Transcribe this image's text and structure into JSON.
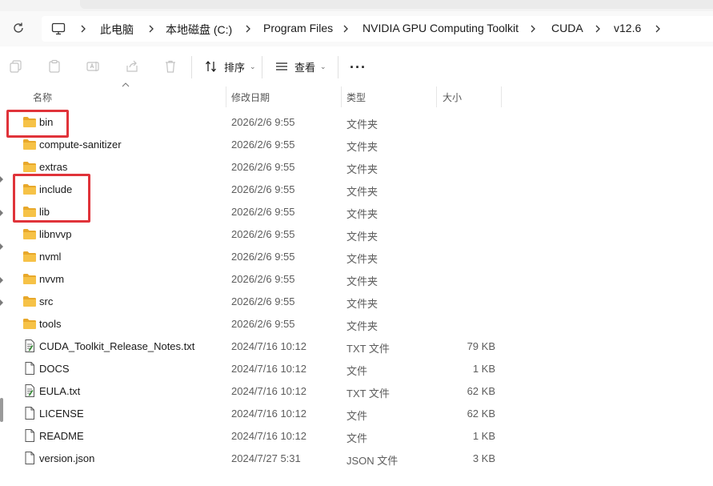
{
  "breadcrumb": [
    "此电脑",
    "本地磁盘 (C:)",
    "Program Files",
    "NVIDIA GPU Computing Toolkit",
    "CUDA",
    "v12.6"
  ],
  "toolbar": {
    "sort_label": "排序",
    "view_label": "查看"
  },
  "columns": {
    "name": "名称",
    "date": "修改日期",
    "type": "类型",
    "size": "大小"
  },
  "files": [
    {
      "name": "bin",
      "date": "2026/2/6 9:55",
      "type": "文件夹",
      "size": "",
      "icon": "folder-icon"
    },
    {
      "name": "compute-sanitizer",
      "date": "2026/2/6 9:55",
      "type": "文件夹",
      "size": "",
      "icon": "folder-icon"
    },
    {
      "name": "extras",
      "date": "2026/2/6 9:55",
      "type": "文件夹",
      "size": "",
      "icon": "folder-icon"
    },
    {
      "name": "include",
      "date": "2026/2/6 9:55",
      "type": "文件夹",
      "size": "",
      "icon": "folder-icon"
    },
    {
      "name": "lib",
      "date": "2026/2/6 9:55",
      "type": "文件夹",
      "size": "",
      "icon": "folder-icon"
    },
    {
      "name": "libnvvp",
      "date": "2026/2/6 9:55",
      "type": "文件夹",
      "size": "",
      "icon": "folder-icon"
    },
    {
      "name": "nvml",
      "date": "2026/2/6 9:55",
      "type": "文件夹",
      "size": "",
      "icon": "folder-icon"
    },
    {
      "name": "nvvm",
      "date": "2026/2/6 9:55",
      "type": "文件夹",
      "size": "",
      "icon": "folder-icon"
    },
    {
      "name": "src",
      "date": "2026/2/6 9:55",
      "type": "文件夹",
      "size": "",
      "icon": "folder-icon"
    },
    {
      "name": "tools",
      "date": "2026/2/6 9:55",
      "type": "文件夹",
      "size": "",
      "icon": "folder-icon"
    },
    {
      "name": "CUDA_Toolkit_Release_Notes.txt",
      "date": "2024/7/16 10:12",
      "type": "TXT 文件",
      "size": "79 KB",
      "icon": "text-file-icon"
    },
    {
      "name": "DOCS",
      "date": "2024/7/16 10:12",
      "type": "文件",
      "size": "1 KB",
      "icon": "file-icon"
    },
    {
      "name": "EULA.txt",
      "date": "2024/7/16 10:12",
      "type": "TXT 文件",
      "size": "62 KB",
      "icon": "text-file-icon"
    },
    {
      "name": "LICENSE",
      "date": "2024/7/16 10:12",
      "type": "文件",
      "size": "62 KB",
      "icon": "file-icon"
    },
    {
      "name": "README",
      "date": "2024/7/16 10:12",
      "type": "文件",
      "size": "1 KB",
      "icon": "file-icon"
    },
    {
      "name": "version.json",
      "date": "2024/7/27 5:31",
      "type": "JSON 文件",
      "size": "3 KB",
      "icon": "file-icon"
    }
  ],
  "highlighted": [
    "bin",
    "include",
    "lib"
  ],
  "colors": {
    "highlight": "#e0333a",
    "folder": "#f6c247",
    "background": "#ffffff",
    "address_bar": "#f9f9f9"
  }
}
